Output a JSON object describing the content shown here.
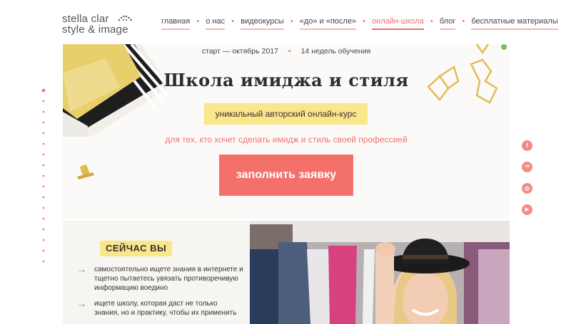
{
  "header": {
    "logo_line1": "stella clar",
    "logo_line2": "style & image",
    "nav": [
      {
        "label": "главная",
        "active": false
      },
      {
        "label": "о нас",
        "active": false
      },
      {
        "label": "видеокурсы",
        "active": false
      },
      {
        "label": "«до» и «после»",
        "active": false
      },
      {
        "label": "онлайн-школа",
        "active": true
      },
      {
        "label": "блог",
        "active": false
      },
      {
        "label": "бесплатные материалы",
        "active": false
      }
    ]
  },
  "hero": {
    "start": "старт — октябрь 2017",
    "duration": "14 недель обучения",
    "title": "Школа имиджа и стиля",
    "badge": "уникальный авторский онлайн-курс",
    "subtitle": "для тех, кто хочет сделать имидж и стиль своей профессией",
    "cta": "заполнить заявку"
  },
  "section": {
    "title": "СЕЙЧАС ВЫ",
    "items": [
      "самостоятельно ищете знания в интернете и тщетно пытаетесь увязать противоречивую информацию воедино",
      "ищете школу, которая даст не только знания, но и практику, чтобы их применить"
    ]
  },
  "social": [
    {
      "icon": "facebook-icon",
      "glyph": "f"
    },
    {
      "icon": "vk-icon",
      "glyph": "vk"
    },
    {
      "icon": "instagram-icon",
      "glyph": "◎"
    },
    {
      "icon": "youtube-icon",
      "glyph": "▶"
    }
  ],
  "colors": {
    "accent": "#f4706b",
    "highlight": "#fbe68a",
    "gold": "#e6c35a"
  }
}
